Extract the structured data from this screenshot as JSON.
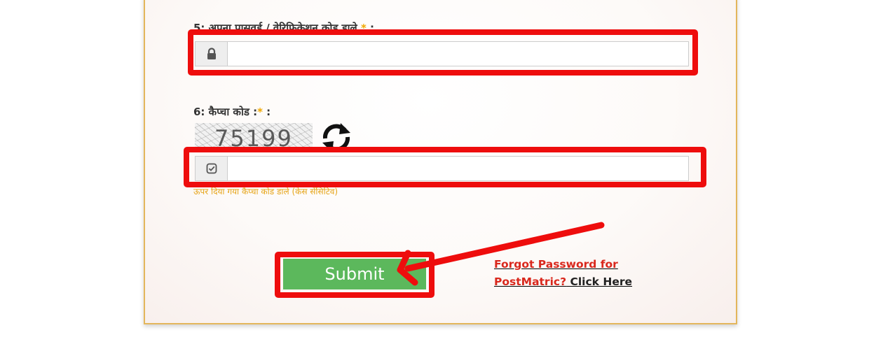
{
  "password_field": {
    "label": "5: अपना पासवर्ड / वेरिफिकेशन कोड डाले",
    "required_mark": "*",
    "label_suffix": " :",
    "icon": "lock-icon",
    "value": ""
  },
  "captcha_field": {
    "label": "6: कैप्चा कोड :",
    "required_mark": "*",
    "label_suffix": " :",
    "captcha_code": "75199",
    "refresh_icon": "refresh-icon",
    "icon": "check-square-icon",
    "value": "",
    "hint": "ऊपर दिया गया कैप्चा कोड डाले (केस सेंसिटिव)"
  },
  "actions": {
    "submit_label": "Submit",
    "forgot_password_text": "Forgot Password for PostMatric?",
    "click_here_text": "Click Here"
  },
  "colors": {
    "highlight_red": "#ee0d0d",
    "submit_green": "#5cb85c",
    "required_orange": "#f0a800",
    "link_red": "#d9281d",
    "card_border": "#e3b65b"
  }
}
